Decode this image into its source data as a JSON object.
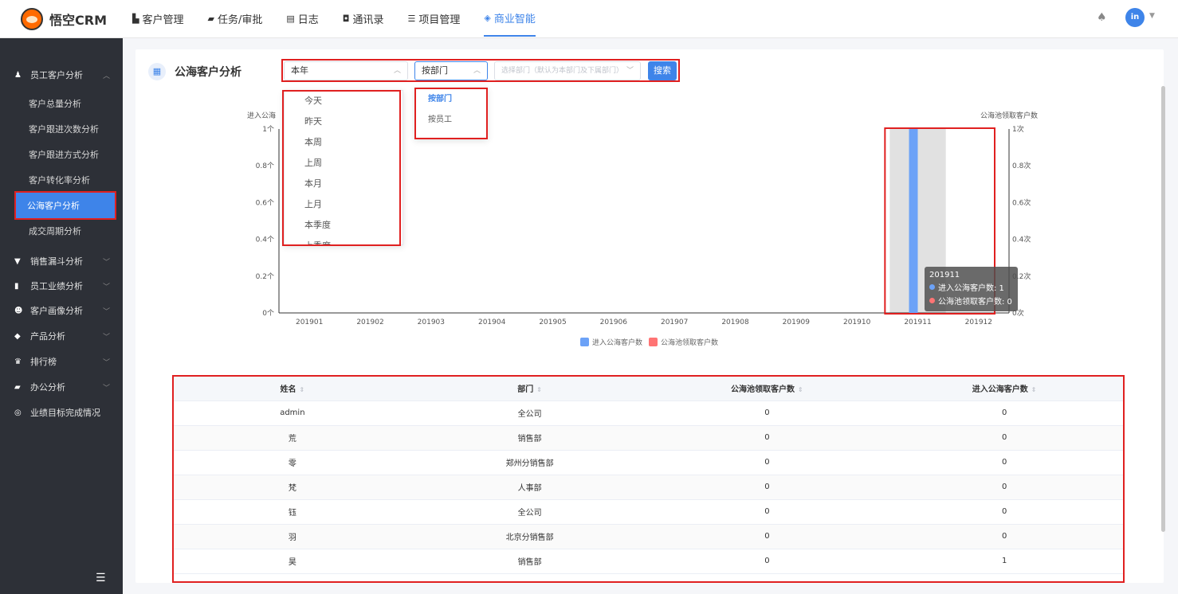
{
  "app": {
    "name": "悟空CRM"
  },
  "nav": [
    {
      "label": "客户管理",
      "icon": "building-icon",
      "glyph": "▙"
    },
    {
      "label": "任务/审批",
      "icon": "briefcase-icon",
      "glyph": "▰"
    },
    {
      "label": "日志",
      "icon": "log-icon",
      "glyph": "▤"
    },
    {
      "label": "通讯录",
      "icon": "contacts-icon",
      "glyph": "◘"
    },
    {
      "label": "项目管理",
      "icon": "project-icon",
      "glyph": "☰"
    },
    {
      "label": "商业智能",
      "icon": "bi-icon",
      "glyph": "◈"
    }
  ],
  "user": {
    "avatar": "in"
  },
  "sidebar": {
    "groups": [
      {
        "label": "员工客户分析",
        "icon": "user-icon",
        "glyph": "♟"
      },
      {
        "label": "销售漏斗分析",
        "icon": "funnel-icon",
        "glyph": "▼"
      },
      {
        "label": "员工业绩分析",
        "icon": "bar-chart-icon",
        "glyph": "▮"
      },
      {
        "label": "客户画像分析",
        "icon": "people-icon",
        "glyph": "☻"
      },
      {
        "label": "产品分析",
        "icon": "box-icon",
        "glyph": "◆"
      },
      {
        "label": "排行榜",
        "icon": "trophy-icon",
        "glyph": "♛"
      },
      {
        "label": "办公分析",
        "icon": "briefcase-icon",
        "glyph": "▰"
      },
      {
        "label": "业绩目标完成情况",
        "icon": "target-icon",
        "glyph": "◎"
      }
    ],
    "sub_items": [
      "客户总量分析",
      "客户跟进次数分析",
      "客户跟进方式分析",
      "客户转化率分析",
      "公海客户分析",
      "成交周期分析"
    ],
    "active_item": "公海客户分析"
  },
  "page": {
    "title": "公海客户分析"
  },
  "filters": {
    "time_value": "本年",
    "group_value": "按部门",
    "dept_placeholder": "选择部门（默认为本部门及下属部门）",
    "search_label": "搜索"
  },
  "time_options": [
    "今天",
    "昨天",
    "本周",
    "上周",
    "本月",
    "上月",
    "本季度",
    "上季度"
  ],
  "group_options": [
    "按部门",
    "按员工"
  ],
  "chart_data": {
    "type": "bar",
    "categories": [
      "201901",
      "201902",
      "201903",
      "201904",
      "201905",
      "201906",
      "201907",
      "201908",
      "201909",
      "201910",
      "201911",
      "201912"
    ],
    "series": [
      {
        "name": "进入公海客户数",
        "color": "#6ca2f7",
        "axis": "left",
        "values": [
          0,
          0,
          0,
          0,
          0,
          0,
          0,
          0,
          0,
          0,
          1,
          0
        ]
      },
      {
        "name": "公海池领取客户数",
        "color": "#ff7474",
        "axis": "right",
        "values": [
          0,
          0,
          0,
          0,
          0,
          0,
          0,
          0,
          0,
          0,
          0,
          0
        ]
      }
    ],
    "ylabel_left": "进入公海",
    "ylabel_right": "公海池领取客户数",
    "yticks_left": [
      "0个",
      "0.2个",
      "0.4个",
      "0.6个",
      "0.8个",
      "1个"
    ],
    "yticks_right": [
      "0次",
      "0.2次",
      "0.4次",
      "0.6次",
      "0.8次",
      "1次"
    ],
    "ylim": [
      0,
      1
    ],
    "highlight_category": "201911",
    "legend_position": "bottom"
  },
  "tooltip": {
    "title": "201911",
    "rows": [
      {
        "label": "进入公海客户数: 1",
        "color": "#6ca2f7"
      },
      {
        "label": "公海池领取客户数: 0",
        "color": "#ff7474"
      }
    ]
  },
  "table": {
    "columns": [
      "姓名",
      "部门",
      "公海池领取客户数",
      "进入公海客户数"
    ],
    "rows": [
      [
        "admin",
        "全公司",
        "0",
        "0"
      ],
      [
        "荒",
        "销售部",
        "0",
        "0"
      ],
      [
        "零",
        "郑州分销售部",
        "0",
        "0"
      ],
      [
        "梵",
        "人事部",
        "0",
        "0"
      ],
      [
        "钰",
        "全公司",
        "0",
        "0"
      ],
      [
        "羽",
        "北京分销售部",
        "0",
        "0"
      ],
      [
        "昊",
        "销售部",
        "0",
        "1"
      ]
    ]
  }
}
